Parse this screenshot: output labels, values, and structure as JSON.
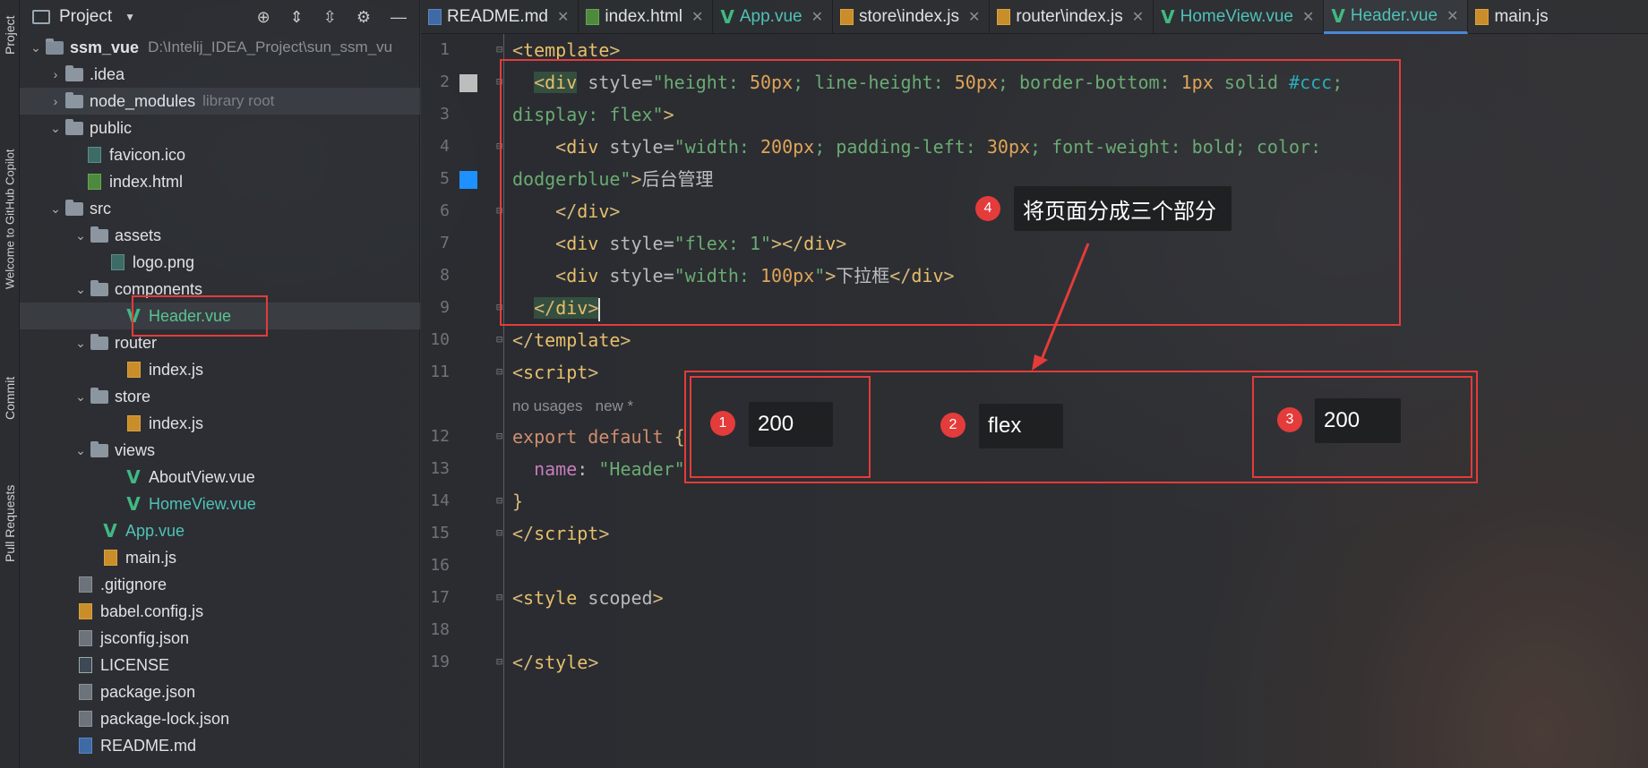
{
  "left_strip": {
    "tabs": [
      "Project",
      "Welcome to GitHub Copilot",
      "Commit",
      "Pull Requests"
    ]
  },
  "project_panel": {
    "title": "Project",
    "root_name": "ssm_vue",
    "root_path": "D:\\Intelij_IDEA_Project\\sun_ssm_vu",
    "library_hint": "library root",
    "items": [
      {
        "label": ".idea"
      },
      {
        "label": "node_modules"
      },
      {
        "label": "public"
      },
      {
        "label": "favicon.ico"
      },
      {
        "label": "index.html"
      },
      {
        "label": "src"
      },
      {
        "label": "assets"
      },
      {
        "label": "logo.png"
      },
      {
        "label": "components"
      },
      {
        "label": "Header.vue"
      },
      {
        "label": "router"
      },
      {
        "label": "index.js"
      },
      {
        "label": "store"
      },
      {
        "label": "index.js"
      },
      {
        "label": "views"
      },
      {
        "label": "AboutView.vue"
      },
      {
        "label": "HomeView.vue"
      },
      {
        "label": "App.vue"
      },
      {
        "label": "main.js"
      },
      {
        "label": ".gitignore"
      },
      {
        "label": "babel.config.js"
      },
      {
        "label": "jsconfig.json"
      },
      {
        "label": "LICENSE"
      },
      {
        "label": "package.json"
      },
      {
        "label": "package-lock.json"
      },
      {
        "label": "README.md"
      }
    ]
  },
  "tabs": [
    {
      "label": "README.md",
      "icon": "md-file-icon"
    },
    {
      "label": "index.html",
      "icon": "html-file-icon"
    },
    {
      "label": "App.vue",
      "icon": "vue-file-icon"
    },
    {
      "label": "store\\index.js",
      "icon": "js-file-icon"
    },
    {
      "label": "router\\index.js",
      "icon": "js-file-icon"
    },
    {
      "label": "HomeView.vue",
      "icon": "vue-file-icon"
    },
    {
      "label": "Header.vue",
      "icon": "vue-file-icon",
      "active": true
    },
    {
      "label": "main.js",
      "icon": "js-file-icon"
    }
  ],
  "editor": {
    "line_numbers": [
      "1",
      "2",
      "3",
      "4",
      "5",
      "6",
      "7",
      "8",
      "9",
      "10",
      "11",
      "",
      "12",
      "13",
      "14",
      "15",
      "16",
      "17",
      "18",
      "19"
    ],
    "usage_hint": "no usages",
    "new_hint": "new *",
    "code": {
      "l1_tag": "template",
      "l2_tag": "div",
      "l2_attr": "style",
      "l2_val_a": "\"height: ",
      "l2_n1": "50px",
      "l2_val_b": "; line-height: ",
      "l2_n2": "50px",
      "l2_val_c": "; border-bottom: ",
      "l2_n3": "1px",
      "l2_val_d": " solid ",
      "l2_hash": "#ccc",
      "l2_val_e": ";",
      "l3_text": "display: flex\"",
      "l4_tag": "div",
      "l4_attr": "style",
      "l4_a": "\"width: ",
      "l4_n1": "200px",
      "l4_b": "; padding-left: ",
      "l4_n2": "30px",
      "l4_c": "; font-weight: bold; color:",
      "l5_text": "dodgerblue\"",
      "l5_content": "后台管理",
      "l6_tag": "div",
      "l7_tag": "div",
      "l7_attr": "style",
      "l7_val": "\"flex: 1\"",
      "l8_tag": "div",
      "l8_attr": "style",
      "l8_a": "\"width: ",
      "l8_n": "100px",
      "l8_b": "\"",
      "l8_content": "下拉框",
      "l9_tag": "div",
      "l10_tag": "template",
      "l11_tag": "script",
      "l12_kw1": "export",
      "l12_kw2": "default",
      "l12_brace": "{",
      "l13_prop": "name",
      "l13_str": "\"Header\"",
      "l14_brace": "}",
      "l15_tag": "script",
      "l17_tag": "style",
      "l17_attr": "scoped",
      "l19_tag": "style"
    }
  },
  "annotations": [
    {
      "num": "1",
      "text": "200"
    },
    {
      "num": "2",
      "text": "flex"
    },
    {
      "num": "3",
      "text": "200"
    },
    {
      "num": "4",
      "text": "将页面分成三个部分"
    }
  ],
  "colors": {
    "annotation_red": "#e43b3b",
    "vue_green": "#41b883",
    "active_tab_underline": "#4a87d8"
  }
}
